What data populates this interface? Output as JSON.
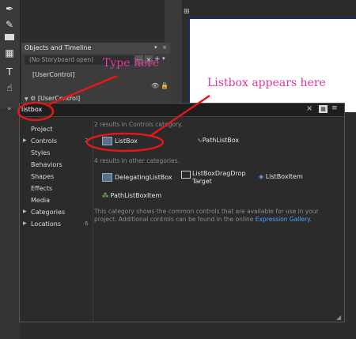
{
  "panel": {
    "title": "Objects and Timeline",
    "storyboard": "(No Storyboard open)",
    "tree": [
      "[UserControl]",
      "[UserControl]"
    ]
  },
  "popup": {
    "search_value": "listbox",
    "categories": [
      {
        "label": "Project",
        "expandable": false,
        "count": ""
      },
      {
        "label": "Controls",
        "expandable": true,
        "count": "2"
      },
      {
        "label": "Styles",
        "expandable": false,
        "count": ""
      },
      {
        "label": "Behaviors",
        "expandable": false,
        "count": ""
      },
      {
        "label": "Shapes",
        "expandable": false,
        "count": ""
      },
      {
        "label": "Effects",
        "expandable": false,
        "count": ""
      },
      {
        "label": "Media",
        "expandable": false,
        "count": ""
      },
      {
        "label": "Categories",
        "expandable": true,
        "count": ""
      },
      {
        "label": "Locations",
        "expandable": true,
        "count": "6"
      }
    ],
    "header_controls": "2 results in Controls category.",
    "controls_results": [
      "ListBox",
      "PathListBox"
    ],
    "header_other": "4 results in other categories.",
    "other_results": [
      "DelegatingListBox",
      "ListBoxDragDrop Target",
      "ListBoxItem",
      "PathListBoxItem"
    ],
    "description": "This category shows the common controls that are available for use in your project. Additional controls can be found in the online ",
    "gallery_link": "Expression Gallery",
    "gallery_end": "."
  },
  "annotations": {
    "type_here": "Type here",
    "listbox_here": "Listbox appears here",
    "color": "#e0379c"
  }
}
